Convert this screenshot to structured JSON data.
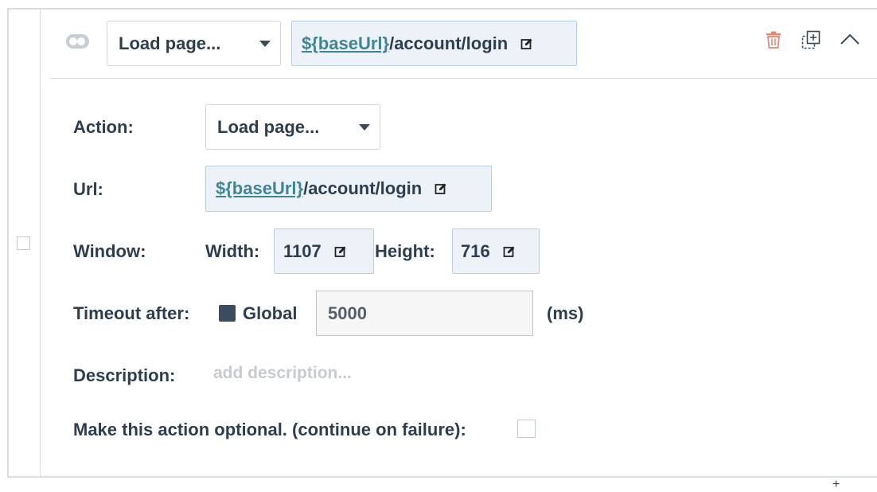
{
  "header": {
    "action_select": "Load page...",
    "url_var": "${baseUrl}",
    "url_path": "/account/login"
  },
  "form": {
    "action": {
      "label": "Action:",
      "value": "Load page..."
    },
    "url": {
      "label": "Url:",
      "var": "${baseUrl}",
      "path": "/account/login"
    },
    "window": {
      "label": "Window:",
      "width_label": "Width:",
      "width_value": "1107",
      "height_label": "Height:",
      "height_value": "716"
    },
    "timeout": {
      "label": "Timeout after:",
      "global_label": "Global",
      "global_checked": true,
      "value": "5000",
      "unit": "(ms)"
    },
    "description": {
      "label": "Description:",
      "placeholder": "add description..."
    },
    "optional": {
      "label": "Make this action optional. (continue on failure):",
      "checked": false
    }
  },
  "footer": {
    "add_glyph": "+"
  },
  "icons": {
    "toggle": "toggle-icon",
    "delete": "trash-icon",
    "duplicate": "duplicate-icon",
    "collapse": "chevron-up-icon",
    "edit": "edit-icon"
  },
  "colors": {
    "text": "#2d3e50",
    "link": "#3d8597",
    "pill_bg": "#edf2f8",
    "pill_border": "#b9cde3",
    "delete": "#e8866f",
    "border": "#d8dde3"
  }
}
